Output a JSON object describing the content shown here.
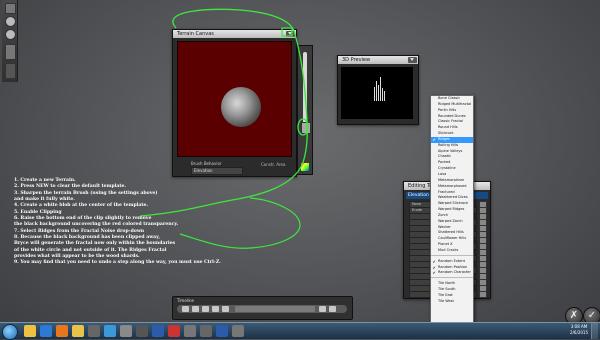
{
  "terrain_canvas": {
    "title": "Terrain Canvas",
    "brush_behavior_label": "Brush Behavior",
    "brush_behavior_value": "Elevation",
    "constrain_label": "Constr. Area"
  },
  "preview": {
    "title": "3D Preview"
  },
  "editing_tools": {
    "title": "Editing Tools",
    "section": "Elevation",
    "rows": [
      "None",
      "Erode",
      "",
      "",
      "",
      "",
      "",
      "",
      "",
      "",
      "",
      "",
      "",
      "",
      "",
      ""
    ]
  },
  "noise_dropdown": {
    "items": [
      {
        "label": "Bone Classic",
        "checked": false,
        "selected": false
      },
      {
        "label": "Ridged Multifractal",
        "checked": false,
        "selected": false
      },
      {
        "label": "Perlin Hills",
        "checked": false,
        "selected": false
      },
      {
        "label": "Rounded Dunes",
        "checked": false,
        "selected": false
      },
      {
        "label": "Classic Fractal",
        "checked": false,
        "selected": false
      },
      {
        "label": "Round Hills",
        "checked": false,
        "selected": false
      },
      {
        "label": "Slickrock",
        "checked": false,
        "selected": false
      },
      {
        "label": "Ridges",
        "checked": true,
        "selected": true
      },
      {
        "label": "Rolling Hills",
        "checked": false,
        "selected": false
      },
      {
        "label": "Alpine Valleys",
        "checked": false,
        "selected": false
      },
      {
        "label": "Chaotic",
        "checked": false,
        "selected": false
      },
      {
        "label": "Pocked",
        "checked": false,
        "selected": false
      },
      {
        "label": "Crystaline",
        "checked": false,
        "selected": false
      },
      {
        "label": "Lava",
        "checked": false,
        "selected": false
      },
      {
        "label": "Metamorphism",
        "checked": false,
        "selected": false
      },
      {
        "label": "Metamorphosed",
        "checked": false,
        "selected": false
      },
      {
        "label": "Fractured",
        "checked": false,
        "selected": false
      },
      {
        "label": "Weathered Dices",
        "checked": false,
        "selected": false
      },
      {
        "label": "Warped Slickrock",
        "checked": false,
        "selected": false
      },
      {
        "label": "Warped Ridges",
        "checked": false,
        "selected": false
      },
      {
        "label": "Zorch",
        "checked": false,
        "selected": false
      },
      {
        "label": "Warped Zorch",
        "checked": false,
        "selected": false
      },
      {
        "label": "Wecker",
        "checked": false,
        "selected": false
      },
      {
        "label": "Shattered Hills",
        "checked": false,
        "selected": false
      },
      {
        "label": "Cauliflower Hills",
        "checked": false,
        "selected": false
      },
      {
        "label": "Planet X",
        "checked": false,
        "selected": false
      },
      {
        "label": "Mud Cracks",
        "checked": false,
        "selected": false
      },
      {
        "sep": true
      },
      {
        "label": "Random Extent",
        "checked": true,
        "selected": false
      },
      {
        "label": "Random Position",
        "checked": true,
        "selected": false
      },
      {
        "label": "Random Character",
        "checked": true,
        "selected": false
      },
      {
        "sep": true
      },
      {
        "label": "Tile North",
        "checked": false,
        "selected": false
      },
      {
        "label": "Tile South",
        "checked": false,
        "selected": false
      },
      {
        "label": "Tile East",
        "checked": false,
        "selected": false
      },
      {
        "label": "Tile West",
        "checked": false,
        "selected": false
      }
    ]
  },
  "instructions": [
    "1. Create a new Terrain.",
    "2. Press NEW to clear the default template.",
    "3. Sharpen the terrain Brush (using the settings above)",
    "    and make it fully white.",
    "4. Create a white blob at the center of the template.",
    "5. Enable Clipping",
    "6. Raise the bottom end of the clip slightly to remove",
    "    the black background uncovering the red colored transparency.",
    "7. Select Ridges from the Fractal Noise drop-down",
    "8. Because the black background has been clipped away,",
    "    Bryce will generate the fractal now only within the boundaries",
    "    of the white circle and not outside of it. The Ridges Fractal",
    "    provides what will appear to be the wood shards.",
    "9. You may find that you need to undo a step along the way, you must use Ctrl-Z."
  ],
  "timeline": {
    "title": "Timeline"
  },
  "corner_buttons": {
    "cancel_glyph": "✗",
    "ok_glyph": "✓"
  },
  "taskbar": {
    "time": "3:08 AM",
    "date": "2/6/2015",
    "icons": [
      "explorer-icon",
      "media-icon",
      "firefox-icon",
      "folder-icon",
      "app-icon",
      "browser-icon",
      "bryce-icon",
      "app-icon",
      "word-icon",
      "paint-icon",
      "app-icon",
      "app-icon",
      "word-icon",
      "app-icon"
    ]
  },
  "colors": {
    "accent_green": "#3ee63e",
    "canvas_red": "#5b0000",
    "selection_blue": "#3399ff"
  }
}
